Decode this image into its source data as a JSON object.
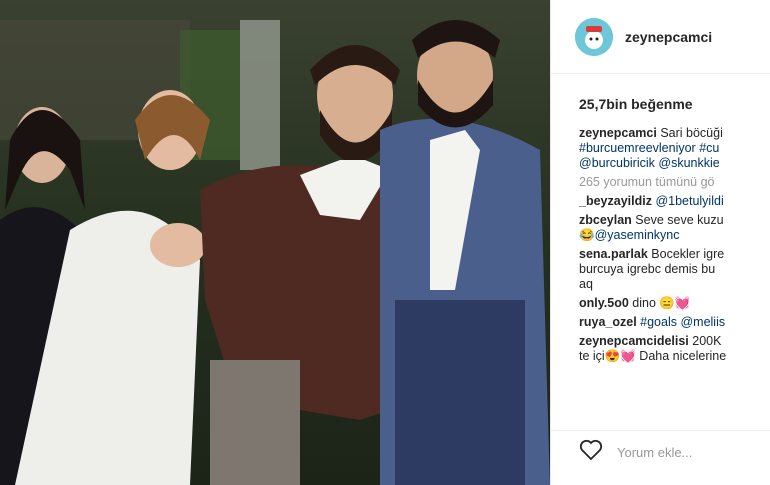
{
  "post": {
    "username": "zeynepcamci",
    "likes": "25,7bin beğenme",
    "photo_icon": "wedding-photo",
    "avatar_icon": "avatar-icon"
  },
  "comments": [
    {
      "user": "zeynepcamci",
      "text": "Sari böcüği",
      "tags": "#burcuemreevleniyor #cu",
      "tags2": "@burcubiricik @skunkkie"
    },
    {
      "more": "265 yorumun tümünü gö"
    },
    {
      "user": "_beyzayildiz",
      "tags": "@1betulyildi"
    },
    {
      "user": "zbceylan",
      "text": "Seve seve kuzu",
      "tags2": "😂@yaseminkync"
    },
    {
      "user": "sena.parlak",
      "text": "Bocekler igre",
      "text2": "burcuya igrebc demis bu",
      "text3": "aq"
    },
    {
      "user": "only.5o0",
      "text": "dino 😑💓"
    },
    {
      "user": "ruya_ozel",
      "tags": "#goals @meliis"
    },
    {
      "user": "zeynepcamcidelisi",
      "text": "200K",
      "text2": "te içi😍💓 Daha nicelerine"
    }
  ],
  "footer": {
    "add_comment_placeholder": "Yorum ekle..."
  }
}
